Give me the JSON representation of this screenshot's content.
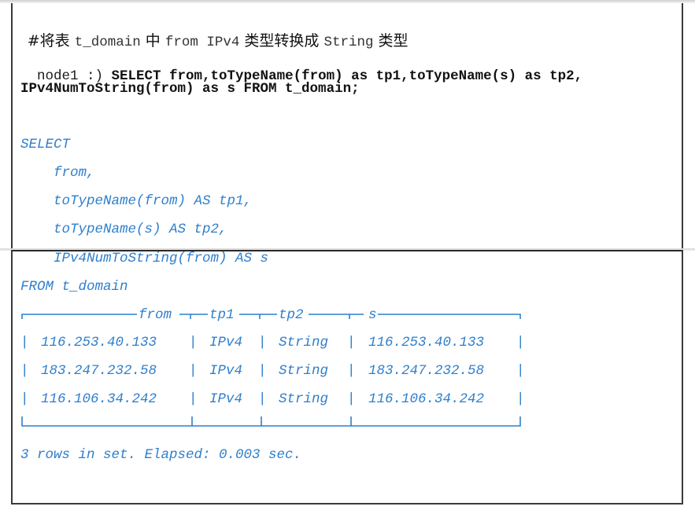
{
  "comment": {
    "parts": [
      {
        "text": "#将表 ",
        "kind": "cjk"
      },
      {
        "text": "t_domain",
        "kind": "mono"
      },
      {
        "text": " 中 ",
        "kind": "cjk"
      },
      {
        "text": "from IPv4",
        "kind": "mono"
      },
      {
        "text": " 类型转换成 ",
        "kind": "cjk"
      },
      {
        "text": "String",
        "kind": "mono"
      },
      {
        "text": " 类型",
        "kind": "cjk"
      }
    ]
  },
  "command": {
    "prompt": "node1 :) ",
    "line1": "SELECT from,toTypeName(from) as tp1,toTypeName(s) as tp2,",
    "line2": "IPv4NumToString(from) as s FROM t_domain;"
  },
  "formatted_query": [
    "SELECT",
    "    from,",
    "    toTypeName(from) AS tp1,",
    "    toTypeName(s) AS tp2,",
    "    IPv4NumToString(from) AS s",
    "FROM t_domain"
  ],
  "result_table": {
    "columns": [
      "from",
      "tp1",
      "tp2",
      "s"
    ],
    "rows": [
      [
        "116.253.40.133",
        "IPv4",
        "String",
        "116.253.40.133"
      ],
      [
        "183.247.232.58",
        "IPv4",
        "String",
        "183.247.232.58"
      ],
      [
        "116.106.34.242",
        "IPv4",
        "String",
        "116.106.34.242"
      ]
    ]
  },
  "footer": "3 rows in set. Elapsed: 0.003 sec.",
  "colors": {
    "output_blue": "#2f7fcc",
    "text_black": "#111111",
    "border": "#3a3a3a"
  }
}
